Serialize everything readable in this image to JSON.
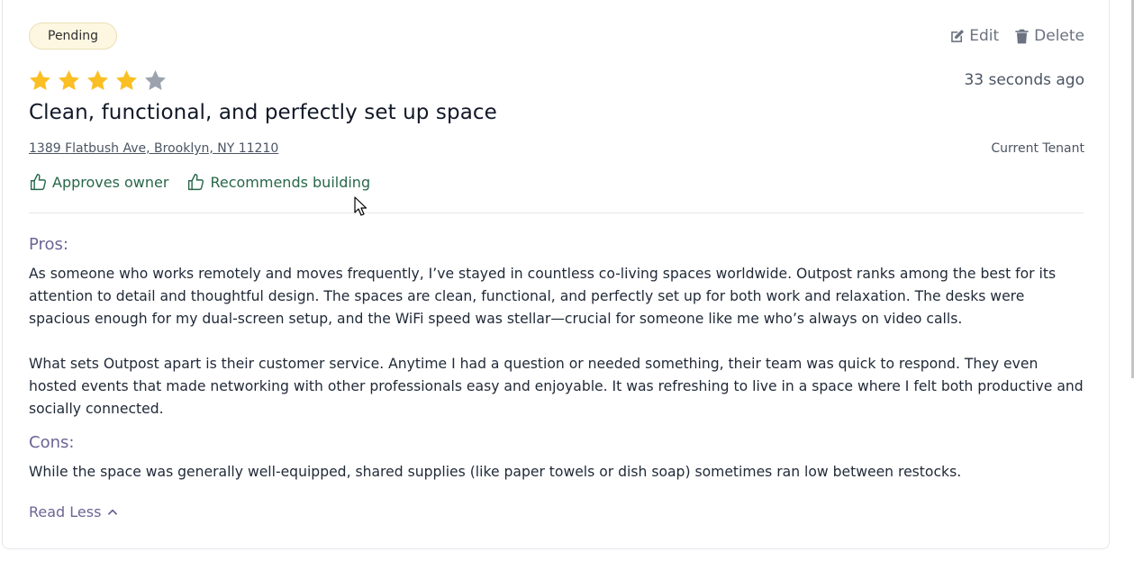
{
  "review": {
    "status": "Pending",
    "actions": {
      "edit": "Edit",
      "delete": "Delete"
    },
    "rating": {
      "value": 4,
      "max": 5
    },
    "timestamp": "33 seconds ago",
    "title": "Clean, functional, and perfectly set up space",
    "address": "1389 Flatbush Ave, Brooklyn, NY 11210",
    "tenant_type": "Current Tenant",
    "approvals": [
      "Approves owner",
      "Recommends building"
    ],
    "pros_label": "Pros:",
    "pros": [
      "As someone who works remotely and moves frequently, I’ve stayed in countless co-living spaces worldwide. Outpost ranks among the best for its attention to detail and thoughtful design. The spaces are clean, functional, and perfectly set up for both work and relaxation. The desks were spacious enough for my dual-screen setup, and the WiFi speed was stellar—crucial for someone like me who’s always on video calls.",
      "What sets Outpost apart is their customer service. Anytime I had a question or needed something, their team was quick to respond. They even hosted events that made networking with other professionals easy and enjoyable. It was refreshing to live in a space where I felt both productive and socially connected."
    ],
    "cons_label": "Cons:",
    "cons": "While the space was generally well-equipped, shared supplies (like paper towels or dish soap) sometimes ran low between restocks.",
    "read_less": "Read Less"
  },
  "colors": {
    "star_filled": "#fbbf24",
    "star_empty": "#9ca3af",
    "approval_green": "#276749",
    "section_purple": "#6b6595"
  },
  "icons": {
    "edit": "edit-icon",
    "delete": "trash-icon",
    "approve": "thumbs-up-icon",
    "read_less": "chevron-up-icon"
  }
}
